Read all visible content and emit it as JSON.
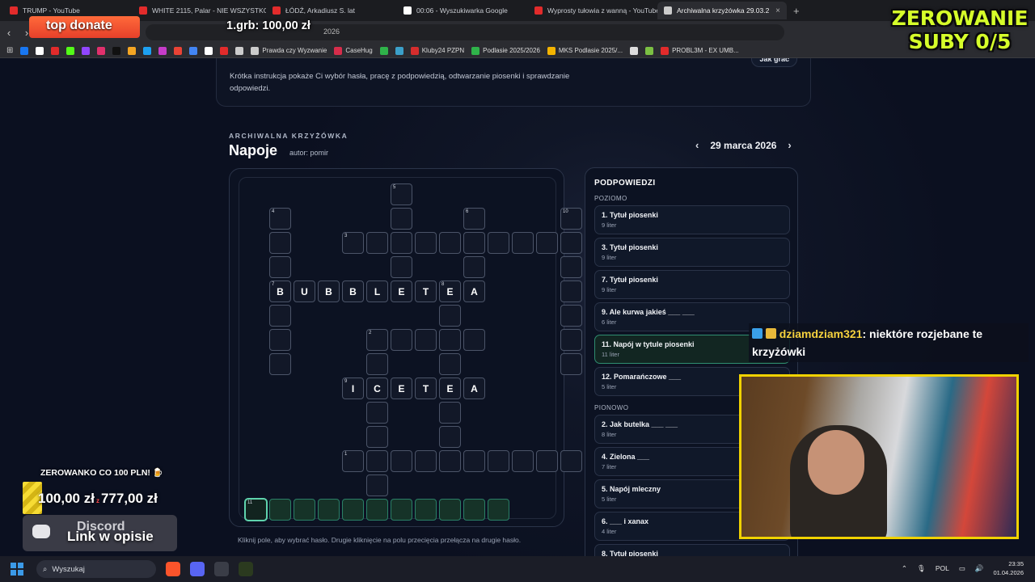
{
  "browser": {
    "tabs": [
      {
        "title": "TRUMP - YouTube",
        "icon": "youtube-icon",
        "color": "#e22b2b"
      },
      {
        "title": "WHITE 2115, Palar - NIE WSZYSTKO Z",
        "icon": "youtube-icon",
        "color": "#e22b2b"
      },
      {
        "title": "ŁÓDŹ, Arkadiusz S. lat",
        "icon": "youtube-icon",
        "color": "#e22b2b"
      },
      {
        "title": "00:06 - Wyszukiwarka Google",
        "icon": "google-icon",
        "color": "#ffffff"
      },
      {
        "title": "Wyprosty tułowia z wanną - YouTube",
        "icon": "youtube-icon",
        "color": "#e22b2b"
      },
      {
        "title": "Archiwalna krzyżówka 29.03.2",
        "icon": "speaker-icon",
        "color": "#cccccc",
        "active": true
      }
    ],
    "url_fragment": "2026",
    "bookmarks": [
      {
        "label": "",
        "color": "#1877f2"
      },
      {
        "label": "",
        "color": "#ffffff"
      },
      {
        "label": "",
        "color": "#e22b2b"
      },
      {
        "label": "",
        "color": "#53fc18"
      },
      {
        "label": "",
        "color": "#9146ff"
      },
      {
        "label": "",
        "color": "#e1306c"
      },
      {
        "label": "",
        "color": "#111111"
      },
      {
        "label": "",
        "color": "#f5a623"
      },
      {
        "label": "",
        "color": "#1da1f2"
      },
      {
        "label": "",
        "color": "#c63cc9"
      },
      {
        "label": "",
        "color": "#ea4335"
      },
      {
        "label": "",
        "color": "#4285f4"
      },
      {
        "label": "",
        "color": "#ffffff"
      },
      {
        "label": "",
        "color": "#e22b2b"
      },
      {
        "label": "",
        "color": "#cccccc"
      },
      {
        "label": "Prawda czy Wyzwanie",
        "color": "#cccccc"
      },
      {
        "label": "CaseHug",
        "color": "#d62d4b"
      },
      {
        "label": "",
        "color": "#2fb34a"
      },
      {
        "label": "",
        "color": "#3ba0c9"
      },
      {
        "label": "Kluby24 PZPN",
        "color": "#d62d2d"
      },
      {
        "label": "Podlasie 2025/2026",
        "color": "#2fb34a"
      },
      {
        "label": "MKS Podlasie 2025/...",
        "color": "#f4b400"
      },
      {
        "label": "",
        "color": "#dddddd"
      },
      {
        "label": "",
        "color": "#7bc043"
      },
      {
        "label": "PROBL3M - EX UMB...",
        "color": "#e22b2b"
      }
    ]
  },
  "overlay": {
    "brand_line1": "ZEROWANIE",
    "brand_line2": "SUBY 0/5",
    "top_donate_label": "top donate",
    "top_donor": "1.grb: 100,00 zł",
    "goal_caption": "ZEROWANKO CO 100 PLN! 🍺",
    "goal_current": "100,00 zł",
    "goal_sep": "z",
    "goal_target": "777,00 zł",
    "goal_progress": 0.13,
    "discord_label": "Discord",
    "discord_link": "Link w opisie",
    "chat_user": "dziamdziam321",
    "chat_message": ": niektóre rozjebane te krzyżówki"
  },
  "intro": {
    "text": "Krótka instrukcja pokaże Ci wybór hasła, pracę z podpowiedzią, odtwarzanie piosenki i sprawdzanie odpowiedzi.",
    "howto_button": "Jak grać"
  },
  "puzzle": {
    "kicker": "ARCHIWALNA KRZYŻÓWKA",
    "title": "Napoje",
    "author": "autor: pomir",
    "date": "29 marca 2026",
    "prev_icon": "chevron-left-icon",
    "next_icon": "chevron-right-icon",
    "board_hint": "Kliknij pole, aby wybrać hasło. Drugie kliknięcie na polu przecięcia przełącza na drugie hasło."
  },
  "grid": {
    "cells": [
      {
        "c": 6,
        "r": 0,
        "n": "5"
      },
      {
        "c": 1,
        "r": 1,
        "n": "4"
      },
      {
        "c": 6,
        "r": 1
      },
      {
        "c": 9,
        "r": 1,
        "n": "6"
      },
      {
        "c": 13,
        "r": 1,
        "n": "10"
      },
      {
        "c": 1,
        "r": 2
      },
      {
        "c": 4,
        "r": 2,
        "n": "3"
      },
      {
        "c": 5,
        "r": 2
      },
      {
        "c": 6,
        "r": 2
      },
      {
        "c": 7,
        "r": 2
      },
      {
        "c": 8,
        "r": 2
      },
      {
        "c": 9,
        "r": 2
      },
      {
        "c": 10,
        "r": 2
      },
      {
        "c": 11,
        "r": 2
      },
      {
        "c": 12,
        "r": 2
      },
      {
        "c": 13,
        "r": 2
      },
      {
        "c": 1,
        "r": 3
      },
      {
        "c": 6,
        "r": 3
      },
      {
        "c": 9,
        "r": 3
      },
      {
        "c": 13,
        "r": 3
      },
      {
        "c": 1,
        "r": 4,
        "n": "7",
        "l": "B"
      },
      {
        "c": 2,
        "r": 4,
        "l": "U"
      },
      {
        "c": 3,
        "r": 4,
        "l": "B"
      },
      {
        "c": 4,
        "r": 4,
        "l": "B"
      },
      {
        "c": 5,
        "r": 4,
        "l": "L"
      },
      {
        "c": 6,
        "r": 4,
        "l": "E"
      },
      {
        "c": 7,
        "r": 4,
        "l": "T"
      },
      {
        "c": 8,
        "r": 4,
        "n": "8",
        "l": "E"
      },
      {
        "c": 9,
        "r": 4,
        "l": "A"
      },
      {
        "c": 13,
        "r": 4
      },
      {
        "c": 1,
        "r": 5
      },
      {
        "c": 8,
        "r": 5
      },
      {
        "c": 13,
        "r": 5
      },
      {
        "c": 1,
        "r": 6
      },
      {
        "c": 5,
        "r": 6,
        "n": "2"
      },
      {
        "c": 6,
        "r": 6
      },
      {
        "c": 7,
        "r": 6
      },
      {
        "c": 8,
        "r": 6
      },
      {
        "c": 9,
        "r": 6
      },
      {
        "c": 13,
        "r": 6
      },
      {
        "c": 1,
        "r": 7
      },
      {
        "c": 5,
        "r": 7
      },
      {
        "c": 8,
        "r": 7
      },
      {
        "c": 13,
        "r": 7
      },
      {
        "c": 4,
        "r": 8,
        "n": "9",
        "l": "I"
      },
      {
        "c": 5,
        "r": 8,
        "l": "C"
      },
      {
        "c": 6,
        "r": 8,
        "l": "E"
      },
      {
        "c": 7,
        "r": 8,
        "l": "T"
      },
      {
        "c": 8,
        "r": 8,
        "l": "E"
      },
      {
        "c": 9,
        "r": 8,
        "l": "A"
      },
      {
        "c": 5,
        "r": 9
      },
      {
        "c": 8,
        "r": 9
      },
      {
        "c": 5,
        "r": 10
      },
      {
        "c": 8,
        "r": 10
      },
      {
        "c": 4,
        "r": 11,
        "n": "1"
      },
      {
        "c": 5,
        "r": 11
      },
      {
        "c": 6,
        "r": 11
      },
      {
        "c": 7,
        "r": 11
      },
      {
        "c": 8,
        "r": 11
      },
      {
        "c": 9,
        "r": 11
      },
      {
        "c": 10,
        "r": 11
      },
      {
        "c": 11,
        "r": 11
      },
      {
        "c": 12,
        "r": 11
      },
      {
        "c": 13,
        "r": 11
      },
      {
        "c": 5,
        "r": 12
      },
      {
        "c": 0,
        "r": 13,
        "n": "11",
        "cur": true
      },
      {
        "c": 1,
        "r": 13,
        "act": true
      },
      {
        "c": 2,
        "r": 13,
        "act": true
      },
      {
        "c": 3,
        "r": 13,
        "act": true
      },
      {
        "c": 4,
        "r": 13,
        "act": true
      },
      {
        "c": 5,
        "r": 13,
        "act": true
      },
      {
        "c": 6,
        "r": 13,
        "act": true
      },
      {
        "c": 7,
        "r": 13,
        "act": true
      },
      {
        "c": 8,
        "r": 13,
        "act": true
      },
      {
        "c": 9,
        "r": 13,
        "act": true
      },
      {
        "c": 10,
        "r": 13,
        "act": true
      }
    ]
  },
  "clues": {
    "heading": "PODPOWIEDZI",
    "across_label": "POZIOMO",
    "down_label": "PIONOWO",
    "across": [
      {
        "title": "1. Tytuł piosenki",
        "len": "9 liter"
      },
      {
        "title": "3. Tytuł piosenki",
        "len": "9 liter"
      },
      {
        "title": "7. Tytuł piosenki",
        "len": "9 liter"
      },
      {
        "title": "9. Ale kurwa jakieś ___ ___",
        "len": "6 liter"
      },
      {
        "title": "11. Napój w tytule piosenki",
        "len": "11 liter",
        "selected": true
      },
      {
        "title": "12. Pomarańczowe ___",
        "len": "5 liter"
      }
    ],
    "down": [
      {
        "title": "2. Jak butelka ___ ___",
        "len": "8 liter"
      },
      {
        "title": "4. Zielona ___",
        "len": "7 liter"
      },
      {
        "title": "5. Napój mleczny",
        "len": "5 liter"
      },
      {
        "title": "6. ___ i xanax",
        "len": "4 liter"
      },
      {
        "title": "8. Tytuł piosenki",
        "len": ""
      }
    ]
  },
  "taskbar": {
    "search_placeholder": "Wyszukaj",
    "lang": "POL",
    "time": "23:35",
    "date": "01.04.2026"
  }
}
